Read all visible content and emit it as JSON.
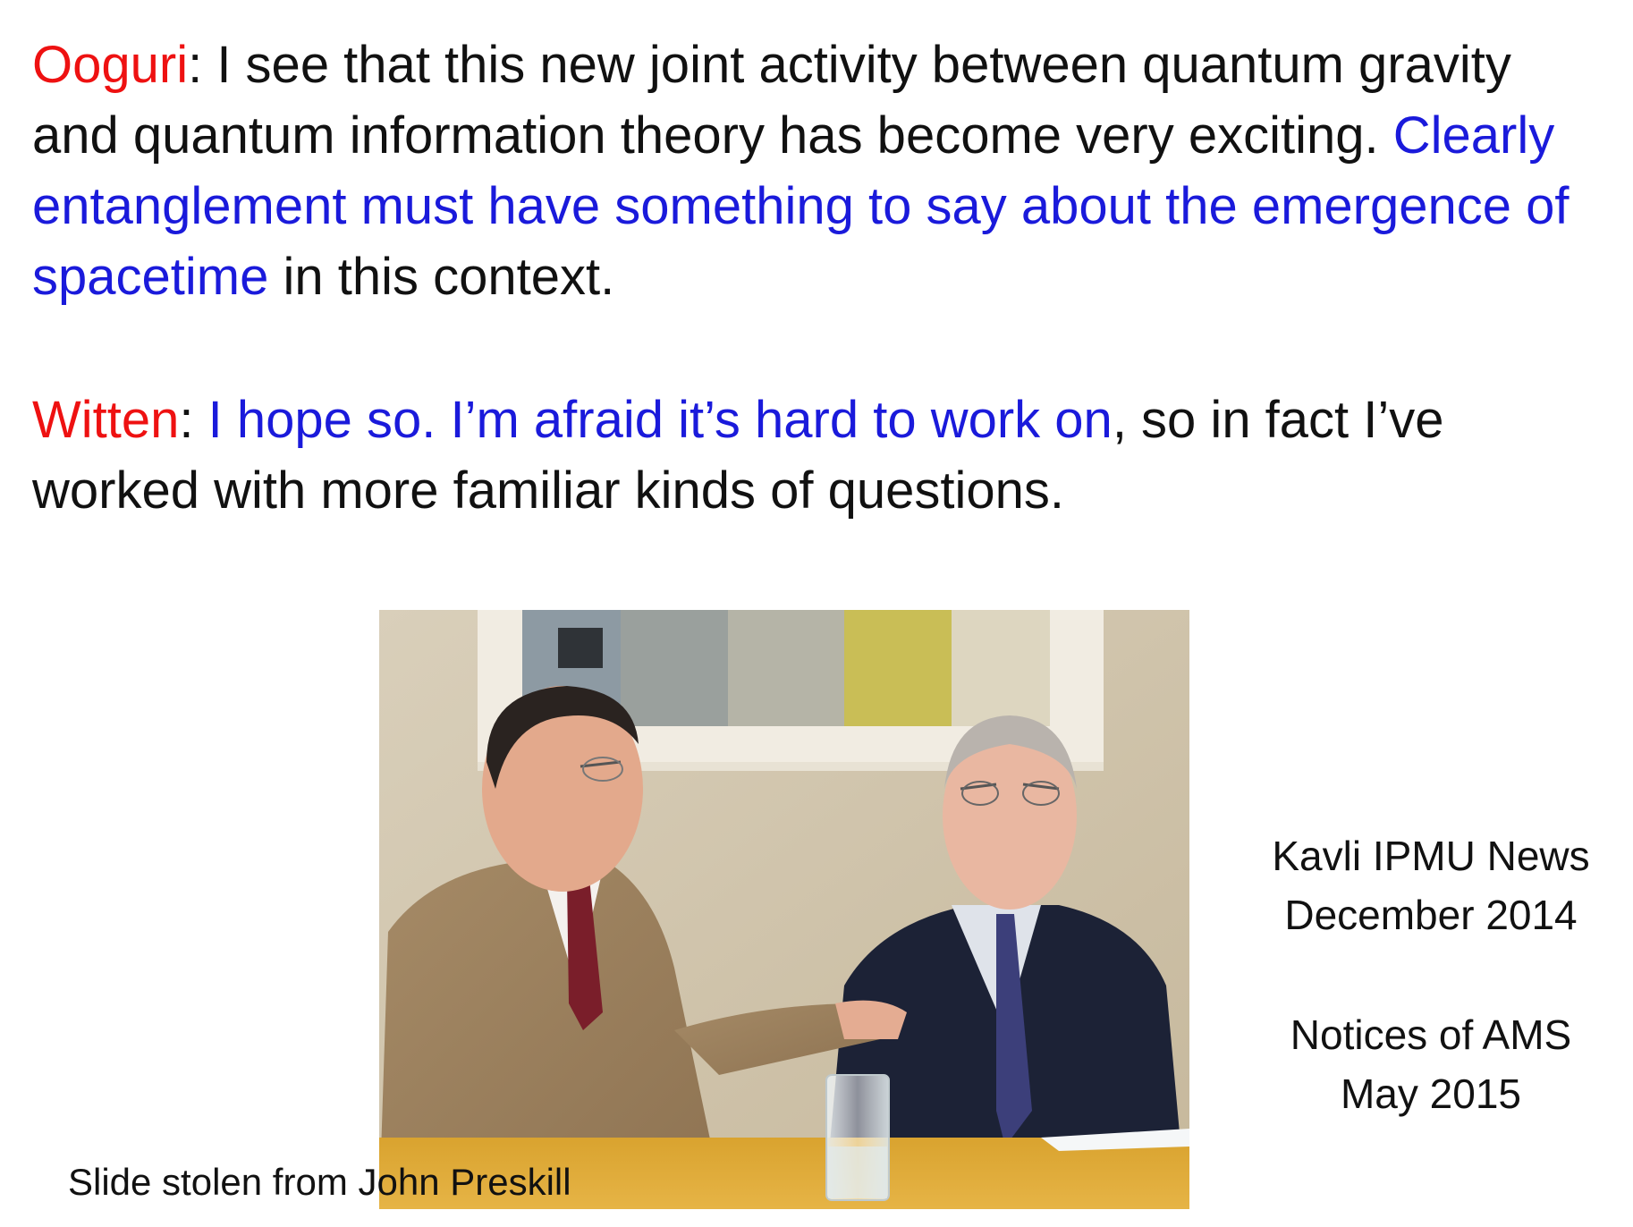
{
  "dialogue": [
    {
      "speaker": "Ooguri",
      "sep": ": ",
      "text1": "I see that this new joint activity between quantum gravity and quantum information theory has become very exciting. ",
      "highlight": "Clearly entanglement must have something to say about the emergence of spacetime",
      "text2": " in this context."
    },
    {
      "speaker": "Witten",
      "sep": ": ",
      "text1": "",
      "highlight": "I hope so. I’m afraid it’s hard to work on",
      "text2": ", so in fact I’ve worked with more familiar kinds of questions."
    }
  ],
  "sources": [
    {
      "line1": "Kavli IPMU News",
      "line2": "December 2014"
    },
    {
      "line1": "Notices of AMS",
      "line2": "May 2015"
    }
  ],
  "caption": "Slide stolen from John Preskill",
  "colors": {
    "speaker": "#ee1111",
    "highlight": "#1a1adb",
    "text": "#111111"
  }
}
